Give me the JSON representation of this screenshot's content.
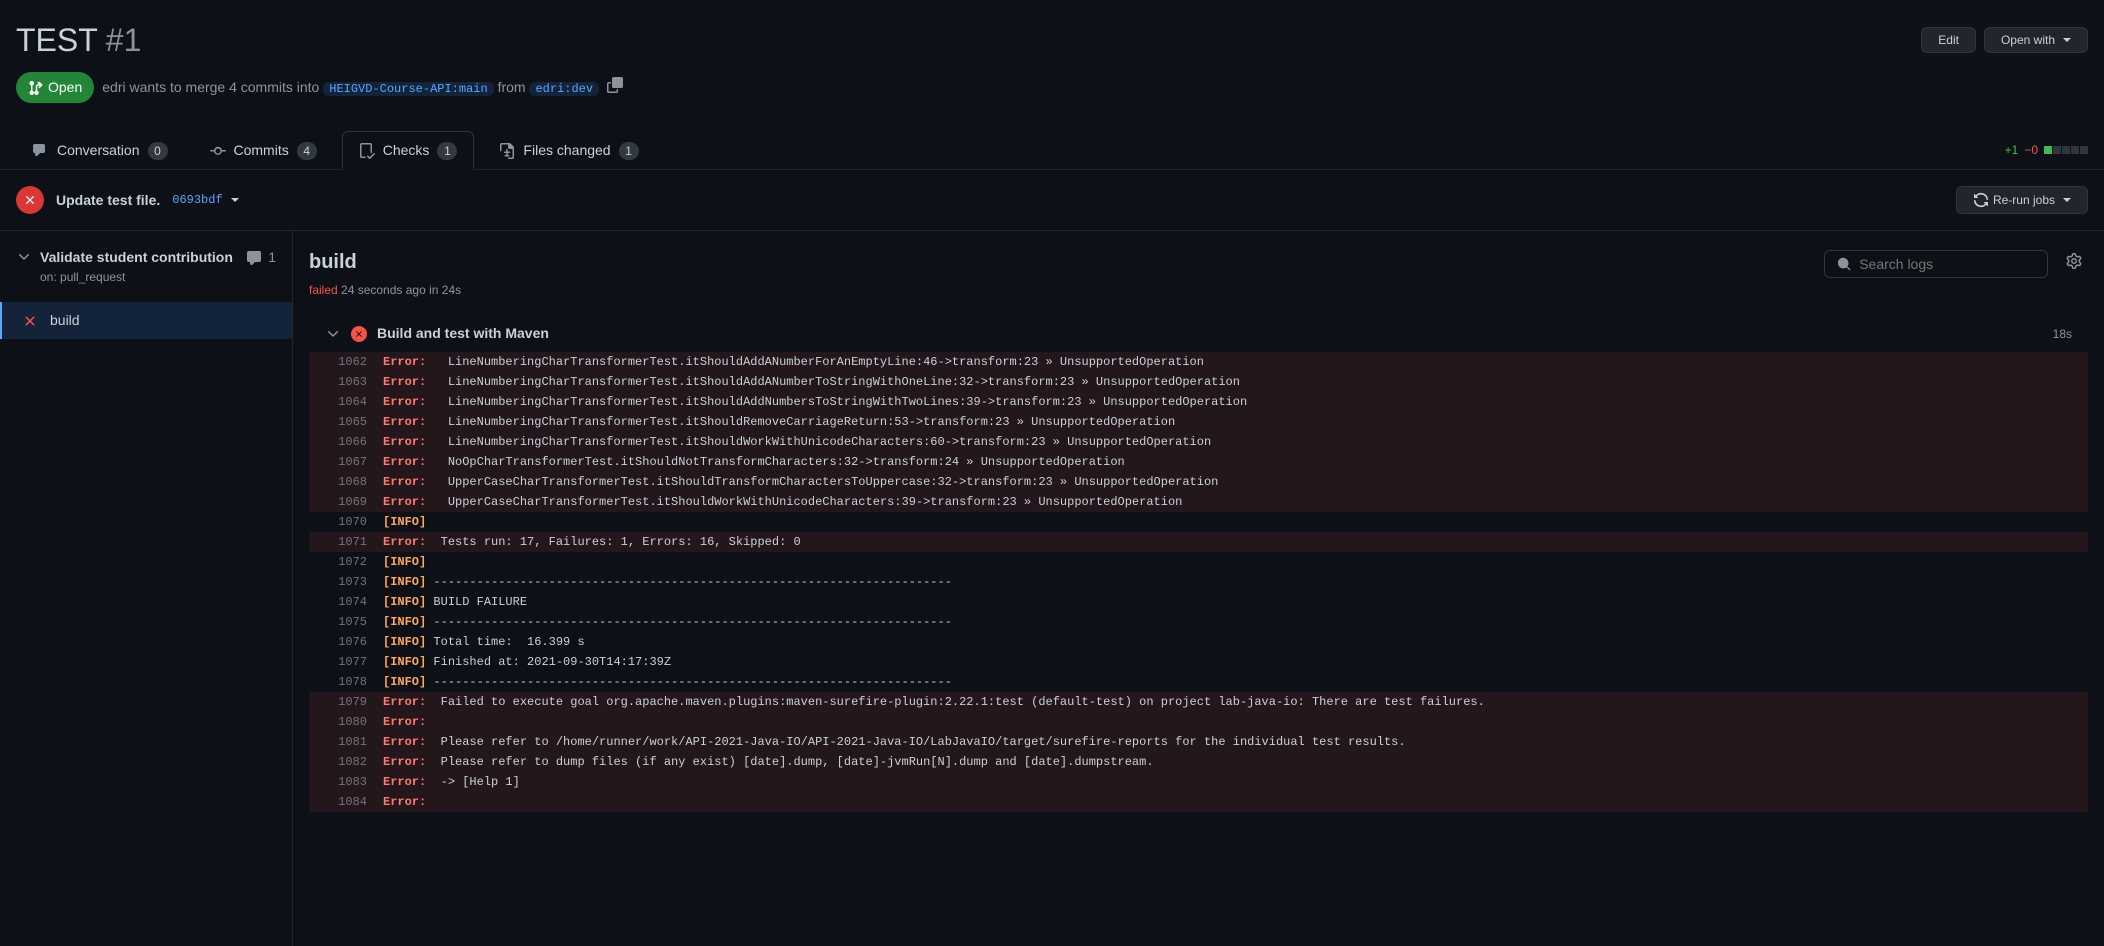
{
  "header": {
    "title_prefix": "TEST",
    "title_number": "#1",
    "edit_label": "Edit",
    "open_with_label": "Open with"
  },
  "meta": {
    "state": "Open",
    "author": "edri",
    "action_text": "wants to merge 4 commits into",
    "base_branch": "HEIGVD-Course-API:main",
    "from_text": "from",
    "head_branch": "edri:dev"
  },
  "tabs": {
    "conversation": {
      "label": "Conversation",
      "count": "0"
    },
    "commits": {
      "label": "Commits",
      "count": "4"
    },
    "checks": {
      "label": "Checks",
      "count": "1"
    },
    "files": {
      "label": "Files changed",
      "count": "1"
    }
  },
  "diffstat": {
    "additions": "+1",
    "deletions": "−0"
  },
  "commit": {
    "title": "Update test file.",
    "sha": "0693bdf",
    "rerun_label": "Re-run jobs"
  },
  "workflow": {
    "name": "Validate student contribution",
    "trigger": "on: pull_request",
    "annotation_count": "1"
  },
  "job_sidebar": {
    "name": "build"
  },
  "job": {
    "title": "build",
    "status": "failed",
    "when": "24 seconds ago",
    "in": "in",
    "duration": "24s",
    "search_placeholder": "Search logs"
  },
  "step": {
    "name": "Build and test with Maven",
    "duration": "18s"
  },
  "log_lines": [
    {
      "num": "1062",
      "tag": "Error:",
      "err": true,
      "text": "   LineNumberingCharTransformerTest.itShouldAddANumberForAnEmptyLine:46->transform:23 » UnsupportedOperation"
    },
    {
      "num": "1063",
      "tag": "Error:",
      "err": true,
      "text": "   LineNumberingCharTransformerTest.itShouldAddANumberToStringWithOneLine:32->transform:23 » UnsupportedOperation"
    },
    {
      "num": "1064",
      "tag": "Error:",
      "err": true,
      "text": "   LineNumberingCharTransformerTest.itShouldAddNumbersToStringWithTwoLines:39->transform:23 » UnsupportedOperation"
    },
    {
      "num": "1065",
      "tag": "Error:",
      "err": true,
      "text": "   LineNumberingCharTransformerTest.itShouldRemoveCarriageReturn:53->transform:23 » UnsupportedOperation"
    },
    {
      "num": "1066",
      "tag": "Error:",
      "err": true,
      "text": "   LineNumberingCharTransformerTest.itShouldWorkWithUnicodeCharacters:60->transform:23 » UnsupportedOperation"
    },
    {
      "num": "1067",
      "tag": "Error:",
      "err": true,
      "text": "   NoOpCharTransformerTest.itShouldNotTransformCharacters:32->transform:24 » UnsupportedOperation"
    },
    {
      "num": "1068",
      "tag": "Error:",
      "err": true,
      "text": "   UpperCaseCharTransformerTest.itShouldTransformCharactersToUppercase:32->transform:23 » UnsupportedOperation"
    },
    {
      "num": "1069",
      "tag": "Error:",
      "err": true,
      "text": "   UpperCaseCharTransformerTest.itShouldWorkWithUnicodeCharacters:39->transform:23 » UnsupportedOperation"
    },
    {
      "num": "1070",
      "tag": "[INFO]",
      "err": false,
      "text": ""
    },
    {
      "num": "1071",
      "tag": "Error:",
      "err": true,
      "text": "  Tests run: 17, Failures: 1, Errors: 16, Skipped: 0"
    },
    {
      "num": "1072",
      "tag": "[INFO]",
      "err": false,
      "text": ""
    },
    {
      "num": "1073",
      "tag": "[INFO]",
      "err": false,
      "text": " ------------------------------------------------------------------------"
    },
    {
      "num": "1074",
      "tag": "[INFO]",
      "err": false,
      "text": " BUILD FAILURE"
    },
    {
      "num": "1075",
      "tag": "[INFO]",
      "err": false,
      "text": " ------------------------------------------------------------------------"
    },
    {
      "num": "1076",
      "tag": "[INFO]",
      "err": false,
      "text": " Total time:  16.399 s"
    },
    {
      "num": "1077",
      "tag": "[INFO]",
      "err": false,
      "text": " Finished at: 2021-09-30T14:17:39Z"
    },
    {
      "num": "1078",
      "tag": "[INFO]",
      "err": false,
      "text": " ------------------------------------------------------------------------"
    },
    {
      "num": "1079",
      "tag": "Error:",
      "err": true,
      "text": "  Failed to execute goal org.apache.maven.plugins:maven-surefire-plugin:2.22.1:test (default-test) on project lab-java-io: There are test failures."
    },
    {
      "num": "1080",
      "tag": "Error:",
      "err": true,
      "text": "  "
    },
    {
      "num": "1081",
      "tag": "Error:",
      "err": true,
      "text": "  Please refer to /home/runner/work/API-2021-Java-IO/API-2021-Java-IO/LabJavaIO/target/surefire-reports for the individual test results."
    },
    {
      "num": "1082",
      "tag": "Error:",
      "err": true,
      "text": "  Please refer to dump files (if any exist) [date].dump, [date]-jvmRun[N].dump and [date].dumpstream."
    },
    {
      "num": "1083",
      "tag": "Error:",
      "err": true,
      "text": "  -> [Help 1]"
    },
    {
      "num": "1084",
      "tag": "Error:",
      "err": true,
      "text": "  "
    }
  ]
}
